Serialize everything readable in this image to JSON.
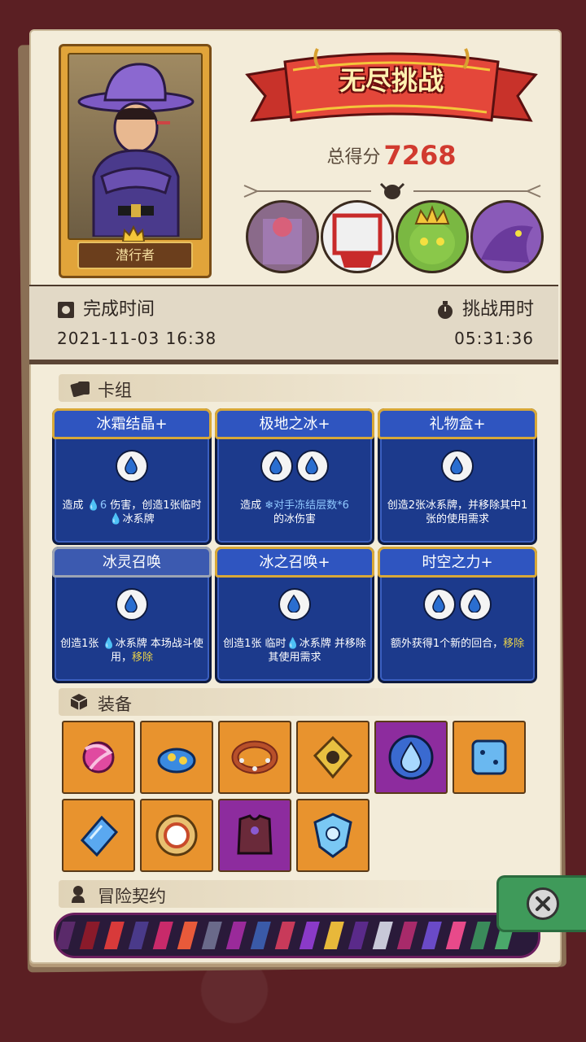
{
  "hero": {
    "name": "潜行者"
  },
  "banner": {
    "title": "无尽挑战"
  },
  "score": {
    "label": "总得分",
    "value": "7268"
  },
  "completion": {
    "label_left": "完成时间",
    "label_right": "挑战用时",
    "date": "2021-11-03  16:38",
    "duration": "05:31:36"
  },
  "sections": {
    "deck": "卡组",
    "equipment": "装备",
    "contract": "冒险契约"
  },
  "cards": [
    {
      "name": "冰霜结晶+",
      "orbs": 1,
      "desc_parts": [
        "造成 ",
        "6",
        " 伤害，创造1张临时",
        "冰系牌"
      ],
      "border": "gold"
    },
    {
      "name": "极地之冰+",
      "orbs": 2,
      "desc_parts": [
        "造成 ",
        "对手冻结层数*6",
        " 的冰伤害"
      ],
      "border": "gold"
    },
    {
      "name": "礼物盒+",
      "orbs": 1,
      "desc_parts": [
        "创造2张冰系牌，并移除其中1张的使用需求"
      ],
      "border": "gold"
    },
    {
      "name": "冰灵召唤",
      "orbs": 1,
      "desc_parts": [
        "创造1张 ",
        "冰系牌 本场战斗使用，",
        "移除"
      ],
      "border": "gray"
    },
    {
      "name": "冰之召唤+",
      "orbs": 1,
      "desc_parts": [
        "创造1张 临时",
        "冰系牌 并移除其使用需求"
      ],
      "border": "gold"
    },
    {
      "name": "时空之力+",
      "orbs": 2,
      "desc_parts": [
        "额外获得1个新的回合，",
        "移除"
      ],
      "border": "gold"
    }
  ],
  "equipment_icons": [
    "dragon-orb-icon",
    "blue-blob-icon",
    "spiked-collar-icon",
    "golden-amulet-icon",
    "water-drop-icon",
    "ice-cube-icon",
    "ice-crystal-icon",
    "ring-shield-icon",
    "purple-armor-icon",
    "ice-shield-icon"
  ],
  "colors": {
    "accent_red": "#d13a2f",
    "card_blue": "#1c3a8c",
    "equip_orange": "#e8932e",
    "equip_purple": "#8d2c9e"
  }
}
